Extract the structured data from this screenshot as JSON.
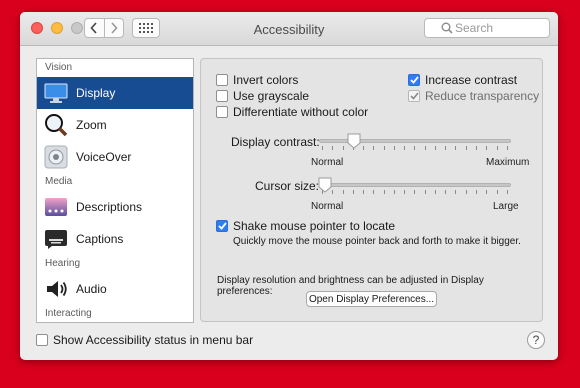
{
  "window": {
    "title": "Accessibility"
  },
  "search": {
    "placeholder": "Search"
  },
  "sidebar": {
    "categories": [
      "Vision",
      "Media",
      "Hearing",
      "Interacting"
    ],
    "items": [
      {
        "label": "Display",
        "icon": "display-icon",
        "selected": true
      },
      {
        "label": "Zoom",
        "icon": "zoom-icon"
      },
      {
        "label": "VoiceOver",
        "icon": "voiceover-icon"
      },
      {
        "label": "Descriptions",
        "icon": "descriptions-icon"
      },
      {
        "label": "Captions",
        "icon": "captions-icon"
      },
      {
        "label": "Audio",
        "icon": "audio-icon"
      }
    ]
  },
  "options": {
    "invert_colors": {
      "label": "Invert colors",
      "checked": false
    },
    "use_grayscale": {
      "label": "Use grayscale",
      "checked": false
    },
    "differentiate": {
      "label": "Differentiate without color",
      "checked": false
    },
    "increase_contrast": {
      "label": "Increase contrast",
      "checked": true
    },
    "reduce_transparency": {
      "label": "Reduce transparency",
      "checked": true,
      "disabled": true
    }
  },
  "display_contrast": {
    "label": "Display contrast:",
    "min_label": "Normal",
    "max_label": "Maximum",
    "value": 0.2
  },
  "cursor_size": {
    "label": "Cursor size:",
    "min_label": "Normal",
    "max_label": "Large",
    "value": 0.0
  },
  "shake": {
    "label": "Shake mouse pointer to locate",
    "checked": true,
    "description": "Quickly move the mouse pointer back and forth to make it bigger."
  },
  "display_note": "Display resolution and brightness can be adjusted in Display preferences:",
  "open_prefs_button": "Open Display Preferences...",
  "footer": {
    "status_label": "Show Accessibility status in menu bar",
    "checked": false,
    "help": "?"
  },
  "colors": {
    "accent": "#2f7df6",
    "selection": "#174c93",
    "background": "#d8001c"
  }
}
